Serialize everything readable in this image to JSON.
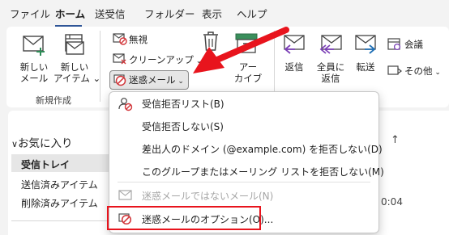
{
  "tabs": [
    {
      "label": "ファイル"
    },
    {
      "label": "ホーム"
    },
    {
      "label": "送受信"
    },
    {
      "label": "フォルダー"
    },
    {
      "label": "表示"
    },
    {
      "label": "ヘルプ"
    }
  ],
  "ribbon": {
    "new_mail": "新しい\nメール",
    "new_items": "新しい\nアイテム",
    "new_group_label": "新規作成",
    "ignore": "無視",
    "cleanup": "クリーンアップ",
    "junk": "迷惑メール",
    "archive": "アー\nカイブ",
    "reply": "返信",
    "reply_all": "全員に\n返信",
    "forward": "転送",
    "meeting": "会議",
    "more": "その他"
  },
  "folder_pane": {
    "favorites": "お気に入り",
    "inbox": "受信トレイ",
    "sent": "送信済みアイテム",
    "deleted": "削除済みアイテム"
  },
  "behind_menu": {
    "time": "0:04"
  },
  "junk_menu": {
    "items": [
      {
        "label": "受信拒否リスト(B)",
        "icon": "block-sender-icon"
      },
      {
        "label": "受信拒否しない(S)",
        "icon": ""
      },
      {
        "label": "差出人のドメイン (@example.com) を拒否しない(D)",
        "icon": ""
      },
      {
        "label": "このグループまたはメーリング リストを拒否しない(M)",
        "icon": ""
      },
      {
        "label": "迷惑メールではないメール(N)",
        "icon": "mail-icon",
        "disabled": true
      },
      {
        "label": "迷惑メールのオプション(O)...",
        "icon": "junk-options-icon"
      }
    ]
  },
  "colors": {
    "annotation_red": "#e8141d",
    "accent_blue": "#2f5597"
  }
}
